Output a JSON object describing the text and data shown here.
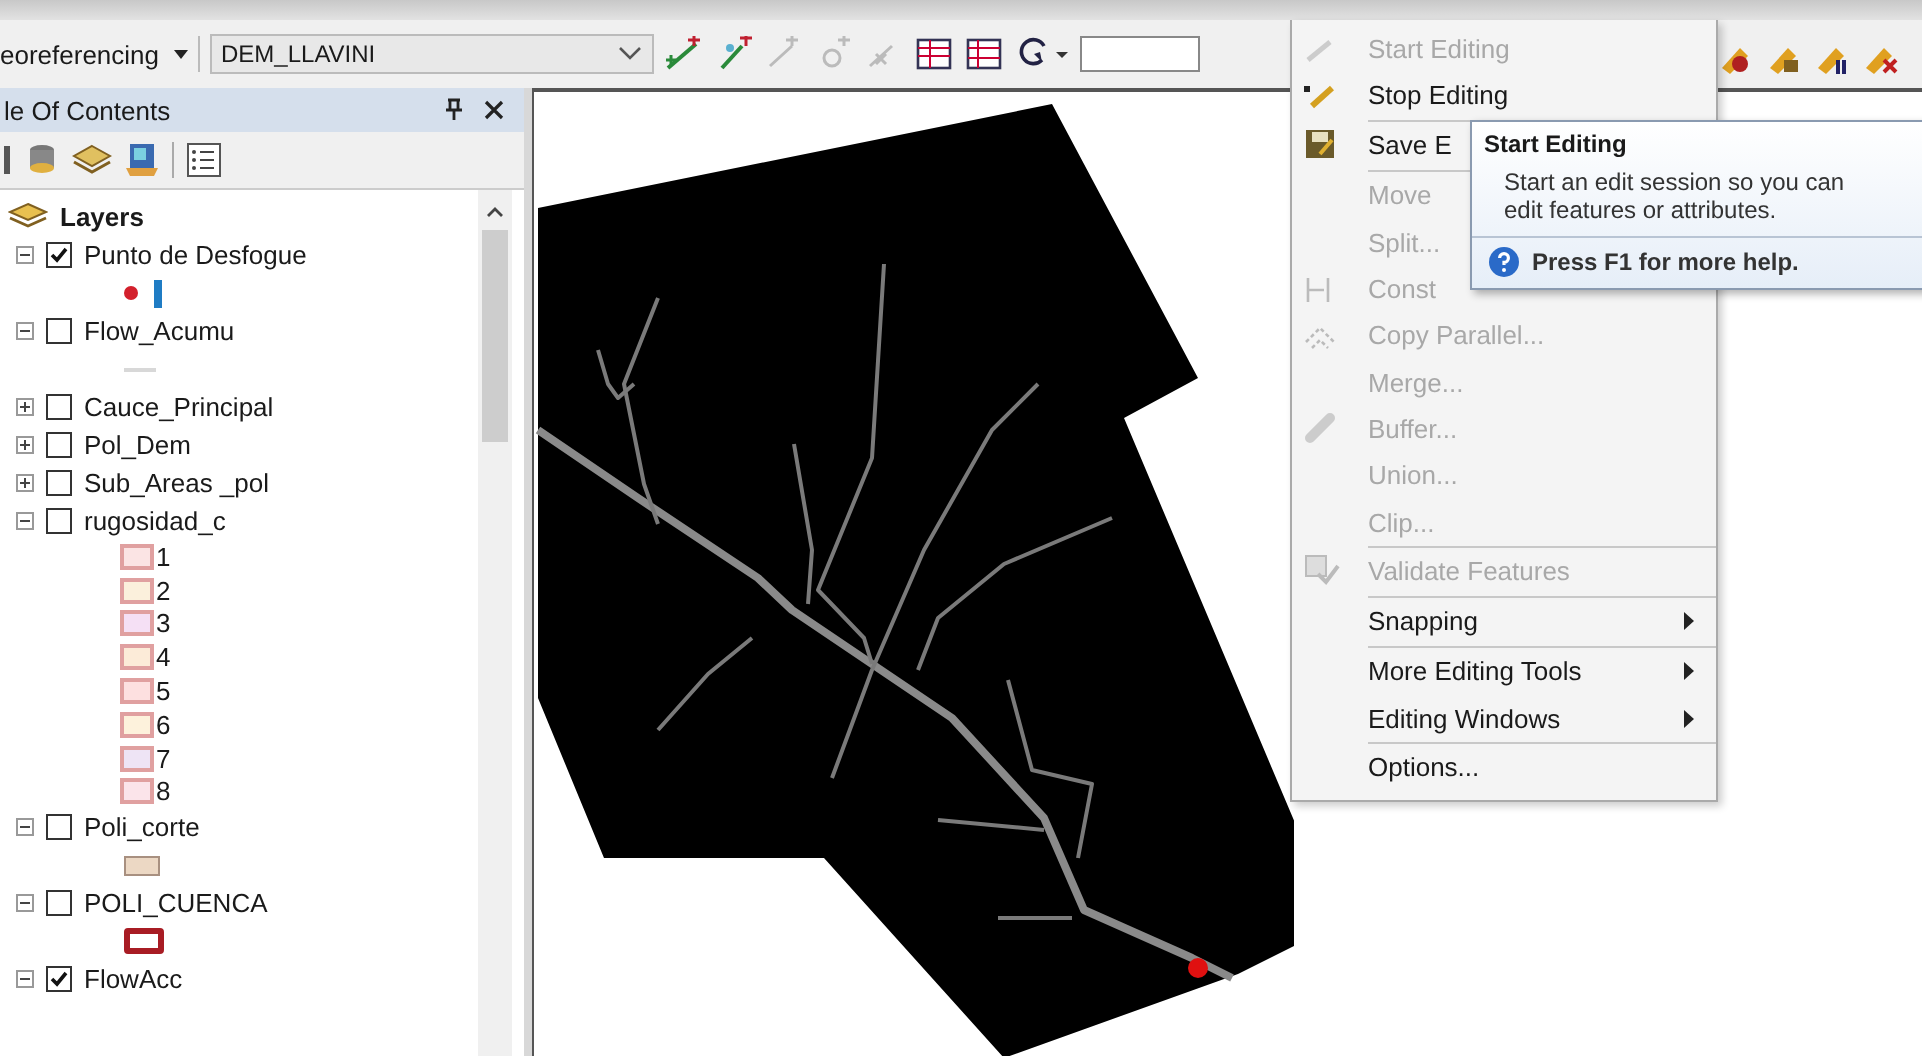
{
  "toolbar": {
    "menu_label": "eoreferencing",
    "layer_dropdown": {
      "value": "DEM_LLAVINI"
    }
  },
  "toc": {
    "title": "le Of Contents",
    "root": {
      "label": "Layers"
    },
    "layers": [
      {
        "name": "Punto de Desfogue",
        "expanded": true,
        "checked": true,
        "legend": [
          {
            "symbols": [
              {
                "kind": "dot",
                "color": "#d3202c"
              },
              {
                "kind": "bar",
                "color": "#1f7cc4"
              }
            ]
          }
        ]
      },
      {
        "name": "Flow_Acumu",
        "expanded": true,
        "checked": false,
        "legend": [
          {
            "symbols": [
              {
                "kind": "line",
                "color": "#d8d8d8"
              }
            ]
          }
        ]
      },
      {
        "name": "Cauce_Principal",
        "expanded": false,
        "checked": false
      },
      {
        "name": "Pol_Dem",
        "expanded": false,
        "checked": false
      },
      {
        "name": "Sub_Areas _pol",
        "expanded": false,
        "checked": false
      },
      {
        "name": "rugosidad_c",
        "expanded": true,
        "checked": false,
        "legend": [
          {
            "label": "1",
            "symbols": [
              {
                "kind": "swatch",
                "color": "#fbe4e4"
              }
            ]
          },
          {
            "label": "2",
            "symbols": [
              {
                "kind": "swatch",
                "color": "#fbf0dc"
              }
            ]
          },
          {
            "label": "3",
            "symbols": [
              {
                "kind": "swatch",
                "color": "#f5e0f5"
              }
            ]
          },
          {
            "label": "4",
            "symbols": [
              {
                "kind": "swatch",
                "color": "#fcebd8"
              }
            ]
          },
          {
            "label": "5",
            "symbols": [
              {
                "kind": "swatch",
                "color": "#fde0e0"
              }
            ]
          },
          {
            "label": "6",
            "symbols": [
              {
                "kind": "swatch",
                "color": "#fdf2dc"
              }
            ]
          },
          {
            "label": "7",
            "symbols": [
              {
                "kind": "swatch",
                "color": "#eee4f5"
              }
            ]
          },
          {
            "label": "8",
            "symbols": [
              {
                "kind": "swatch",
                "color": "#fbe4ea"
              }
            ]
          }
        ]
      },
      {
        "name": "Poli_corte",
        "expanded": true,
        "checked": false,
        "legend": [
          {
            "symbols": [
              {
                "kind": "fill",
                "color": "#ecd8c4"
              }
            ]
          }
        ]
      },
      {
        "name": "POLI_CUENCA",
        "expanded": true,
        "checked": false,
        "legend": [
          {
            "symbols": [
              {
                "kind": "outline",
                "color": "#a81c24"
              }
            ]
          }
        ]
      },
      {
        "name": "FlowAcc",
        "expanded": true,
        "checked": true
      }
    ]
  },
  "editor_menu": {
    "items": [
      {
        "label": "Start Editing",
        "disabled": true,
        "separator": false,
        "submenu": false
      },
      {
        "label": "Stop Editing",
        "disabled": false,
        "separator": false,
        "submenu": false
      },
      {
        "label": "Save E",
        "disabled": false,
        "separator": true,
        "submenu": false
      },
      {
        "label": "Move",
        "disabled": true,
        "separator": true,
        "submenu": false
      },
      {
        "label": "Split...",
        "disabled": true,
        "separator": false,
        "submenu": false
      },
      {
        "label": "Const",
        "disabled": true,
        "separator": false,
        "submenu": false
      },
      {
        "label": "Copy Parallel...",
        "disabled": true,
        "separator": false,
        "submenu": false
      },
      {
        "label": "Merge...",
        "disabled": true,
        "separator": false,
        "submenu": false
      },
      {
        "label": "Buffer...",
        "disabled": true,
        "separator": false,
        "submenu": false
      },
      {
        "label": "Union...",
        "disabled": true,
        "separator": false,
        "submenu": false
      },
      {
        "label": "Clip...",
        "disabled": true,
        "separator": false,
        "submenu": false
      },
      {
        "label": "Validate Features",
        "disabled": true,
        "separator": true,
        "submenu": false
      },
      {
        "label": "Snapping",
        "disabled": false,
        "separator": true,
        "submenu": true
      },
      {
        "label": "More Editing Tools",
        "disabled": false,
        "separator": true,
        "submenu": true
      },
      {
        "label": "Editing Windows",
        "disabled": false,
        "separator": false,
        "submenu": true
      },
      {
        "label": "Options...",
        "disabled": false,
        "separator": true,
        "submenu": false
      }
    ]
  },
  "tooltip": {
    "title": "Start Editing",
    "body": "Start an edit session so you can edit features or attributes.",
    "help": "Press F1 for more help."
  }
}
